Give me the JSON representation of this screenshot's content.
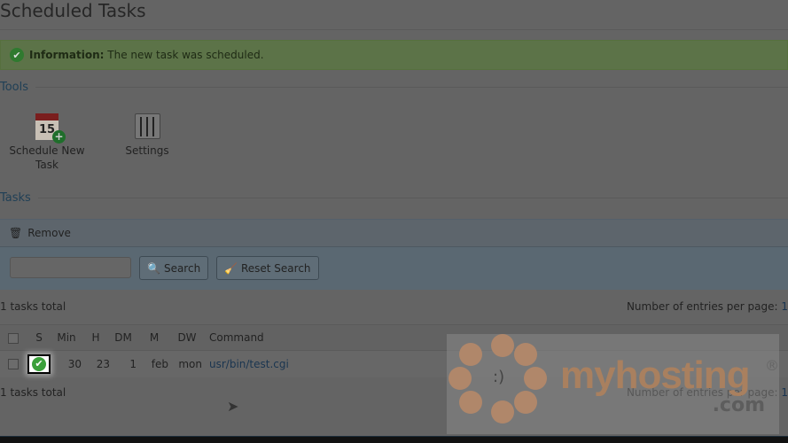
{
  "page_title": "Scheduled Tasks",
  "info": {
    "label": "Information:",
    "message": "The new task was scheduled."
  },
  "tools": {
    "heading": "Tools",
    "items": [
      {
        "label": "Schedule New Task",
        "icon": "calendar-add-icon"
      },
      {
        "label": "Settings",
        "icon": "sliders-icon"
      }
    ]
  },
  "tasks": {
    "heading": "Tasks",
    "remove_label": "Remove",
    "search_placeholder": "",
    "search_label": "Search",
    "reset_label": "Reset Search",
    "total_text": "1 tasks total",
    "entries_label": "Number of entries per page:",
    "entries_value": "1",
    "columns": [
      "S",
      "Min",
      "H",
      "DM",
      "M",
      "DW",
      "Command"
    ],
    "rows": [
      {
        "status": "enabled",
        "min": "30",
        "h": "23",
        "dm": "1",
        "m": "feb",
        "dw": "mon",
        "command": "usr/bin/test.cgi"
      }
    ]
  },
  "watermark": {
    "brand": "myhosting",
    "tld": ".com",
    "reg": "®"
  }
}
